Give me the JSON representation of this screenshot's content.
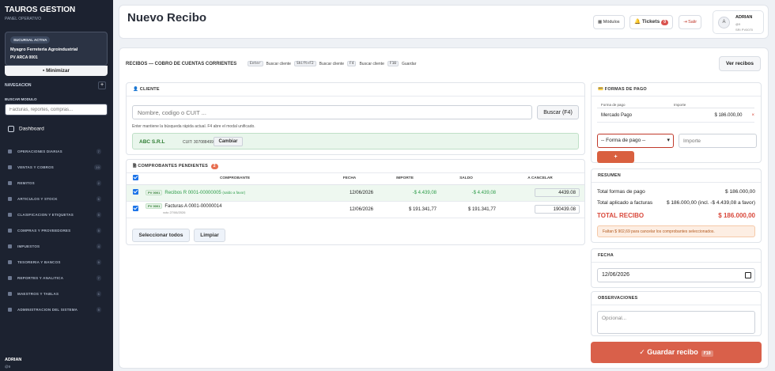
{
  "sidebar": {
    "brand": "TAUROS GESTION",
    "subtitle": "PANEL OPERATIVO",
    "sucursal_badge": "SUCURSAL ACTIVA",
    "sucursal_name": "Myagro Ferreteria Agroindustrial",
    "sucursal_pv": "PV ARCA 0001",
    "minimize_label": "Minimizar",
    "nav_heading": "NAVEGACION",
    "search_label": "BUSCAR MODULO",
    "search_placeholder": "Facturas, reportes, compras...",
    "dashboard_label": "Dashboard",
    "items": [
      {
        "label": "OPERACIONES DIARIAS",
        "count": "7"
      },
      {
        "label": "VENTAS Y COBROS",
        "count": "10"
      },
      {
        "label": "REMITOS",
        "count": "2"
      },
      {
        "label": "ARTICULOS Y STOCK",
        "count": "6"
      },
      {
        "label": "CLASIFICACION Y ETIQUETAS",
        "count": "5"
      },
      {
        "label": "COMPRAS Y PROVEEDORES",
        "count": "5"
      },
      {
        "label": "IMPUESTOS",
        "count": "4"
      },
      {
        "label": "TESORERIA Y BANCOS",
        "count": "9"
      },
      {
        "label": "REPORTES Y ANALITICA",
        "count": "7"
      },
      {
        "label": "MAESTROS Y TABLAS",
        "count": "6"
      },
      {
        "label": "ADMINISTRACION DEL SISTEMA",
        "count": "5"
      }
    ],
    "user_name": "ADRIAN",
    "user_role": "@9"
  },
  "header": {
    "title": "Nuevo Recibo",
    "modulos_label": "Módulos",
    "tickets_label": "Tickets",
    "tickets_count": "0",
    "salir_label": "Salir",
    "avatar_letter": "A",
    "user_name": "ADRIAN",
    "user_role": "@9",
    "user_pv": "SRI PV0070"
  },
  "toolbar": {
    "title": "RECIBOS — COBRO DE CUENTAS CORRIENTES",
    "hints": [
      {
        "key": "Enter",
        "label": "Buscar cliente"
      },
      {
        "key": "Shift+F2",
        "label": "Buscar cliente"
      },
      {
        "key": "F4",
        "label": "Buscar cliente"
      },
      {
        "key": "F10",
        "label": "Guardar"
      }
    ],
    "ver_recibos": "Ver recibos"
  },
  "cliente": {
    "heading": "CLIENTE",
    "placeholder": "Nombre, codigo o CUIT ...",
    "buscar_label": "Buscar (F4)",
    "hint": "Enter mantiene la búsqueda rápida actual. F4 abre el modal unificado.",
    "selected_name": "ABC S.R.L",
    "selected_cuit": "CUIT: 30708849991",
    "cambiar_label": "Cambiar"
  },
  "comprobantes": {
    "heading": "COMPROBANTES PENDIENTES",
    "count": "2",
    "columns": [
      "COMPROBANTE",
      "FECHA",
      "IMPORTE",
      "SALDO",
      "A CANCELAR"
    ],
    "rows": [
      {
        "pv": "PV 0001",
        "comprobante": "Recibos R 0001-00000005",
        "note": "(saldo a favor)",
        "fecha": "12/06/2026",
        "importe": "-$ 4.439,08",
        "saldo": "-$ 4.439,08",
        "a_cancelar": "4439.08"
      },
      {
        "pv": "PV 0001",
        "comprobante": "Facturas A 0001-00000014",
        "note": "vcto 27/06/2026",
        "fecha": "12/06/2026",
        "importe": "$ 191.341,77",
        "saldo": "$ 191.341,77",
        "a_cancelar": "190439.08"
      }
    ],
    "select_all": "Seleccionar todos",
    "clear": "Limpiar"
  },
  "formas_pago": {
    "heading": "FORMAS DE PAGO",
    "col_forma": "Forma de pago",
    "col_importe": "Importe",
    "rows": [
      {
        "forma": "Mercado Pago",
        "importe": "$ 186.000,00"
      }
    ],
    "select_value": "-- Forma de pago --",
    "importe_placeholder": "Importe",
    "add_label": "+"
  },
  "resumen": {
    "heading": "RESUMEN",
    "total_formas_label": "Total formas de pago",
    "total_formas_value": "$ 186.000,00",
    "total_aplicado_label": "Total aplicado a facturas",
    "total_aplicado_value": "$ 186.000,00 (incl. -$ 4.439,08 a favor)",
    "total_recibo_label": "TOTAL RECIBO",
    "total_recibo_value": "$ 186.000,00",
    "warning": "Faltan $ 902,69 para cancelar los comprobantes seleccionados."
  },
  "fecha": {
    "heading": "FECHA",
    "value": "12/06/2026"
  },
  "observaciones": {
    "heading": "OBSERVACIONES",
    "placeholder": "Opcional..."
  },
  "guardar": {
    "label": "✓ Guardar recibo",
    "key": "F10"
  },
  "colors": {
    "accent": "#d9604a",
    "sidebar": "#1c2230",
    "success": "#2e9d4a"
  }
}
